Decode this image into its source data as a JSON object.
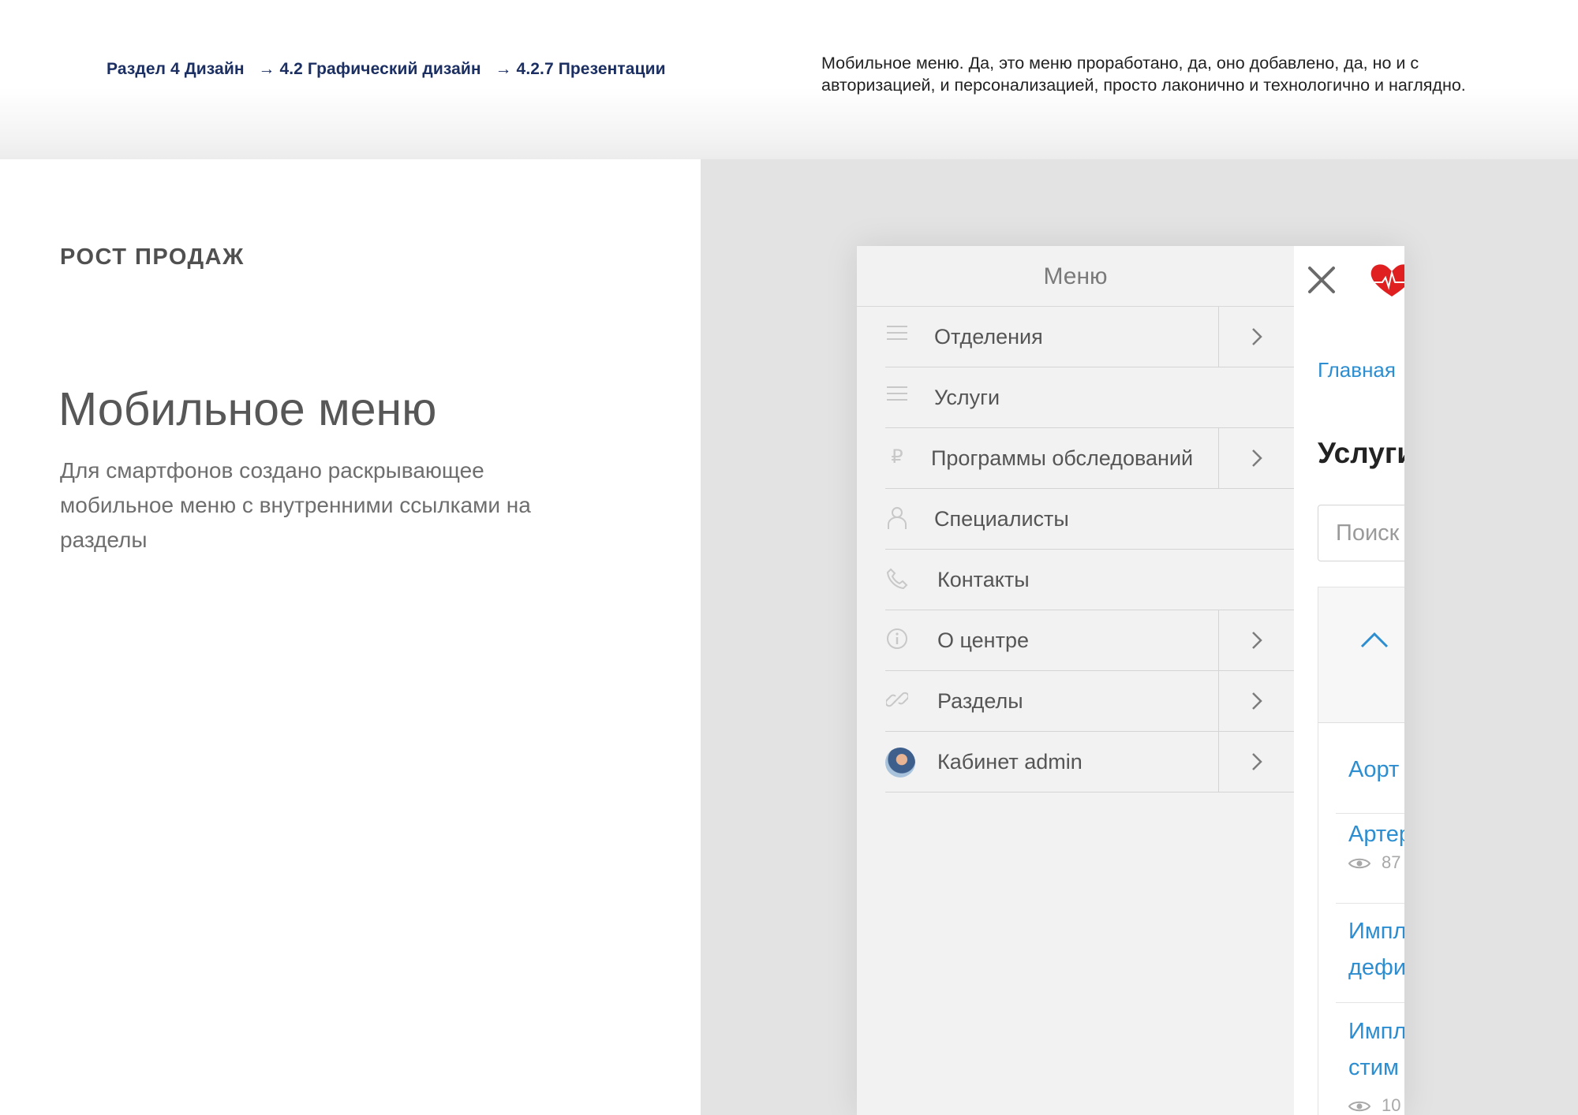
{
  "header": {
    "breadcrumb": {
      "part1": "Раздел 4 Дизайн",
      "part2": "→ 4.2 Графический дизайн",
      "part3": "→ 4.2.7 Презентации"
    },
    "note": "Мобильное меню. Да, это меню проработано, да, оно добавлено, да, но и с авторизацией, и персонализацией, просто лаконично и технологично и наглядно."
  },
  "left": {
    "section_tag": "РОСТ ПРОДАЖ",
    "title": "Мобильное меню",
    "description": "Для смартфонов создано раскрывающее мобильное меню с внутренними ссылками на разделы"
  },
  "mobile_menu": {
    "title": "Меню",
    "items": [
      {
        "label": "Отделения",
        "icon": "list-icon",
        "has_arrow": true
      },
      {
        "label": "Услуги",
        "icon": "list-icon",
        "has_arrow": false
      },
      {
        "label": "Программы обследований",
        "icon": "ruble-icon",
        "has_arrow": true
      },
      {
        "label": "Специалисты",
        "icon": "doctor-icon",
        "has_arrow": false
      },
      {
        "label": "Контакты",
        "icon": "phone-icon",
        "has_arrow": false
      },
      {
        "label": "О центре",
        "icon": "info-icon",
        "has_arrow": true
      },
      {
        "label": "Разделы",
        "icon": "link-icon",
        "has_arrow": true
      },
      {
        "label": "Кабинет admin",
        "icon": "avatar",
        "has_arrow": true
      }
    ]
  },
  "page_behind": {
    "breadcrumb": "Главная",
    "heading": "Услуги",
    "search_placeholder": "Поиск",
    "links": [
      "Аорт",
      "Артер",
      "Импл",
      "дефи",
      "Импл",
      "стим"
    ],
    "counts": [
      "87",
      "10"
    ]
  },
  "colors": {
    "breadcrumb": "#1b2f63",
    "link_blue": "#2c8ed1",
    "heart_red": "#e02020",
    "grey_bg": "#e3e3e3"
  }
}
